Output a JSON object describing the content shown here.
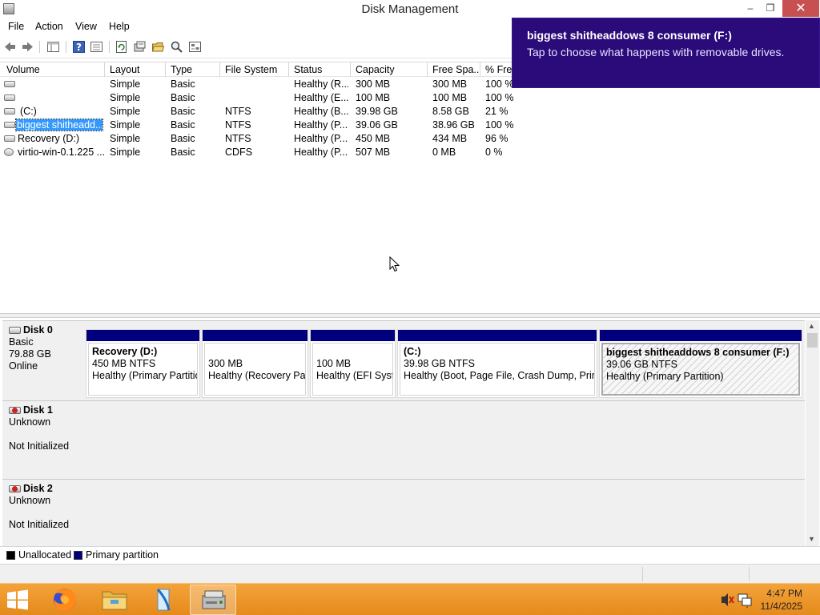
{
  "window": {
    "title": "Disk Management",
    "minimize_glyph": "–",
    "maximize_glyph": "❐",
    "close_glyph": "✕"
  },
  "menu": [
    "File",
    "Action",
    "View",
    "Help"
  ],
  "toolbar_icons": [
    "back-arrow-icon",
    "forward-arrow-icon",
    "console-tree-icon",
    "help-icon",
    "properties-icon",
    "refresh-icon",
    "rescan-disks-icon",
    "open-folder-icon",
    "search-disk-icon",
    "settings-icon"
  ],
  "volume_list": {
    "columns": [
      "Volume",
      "Layout",
      "Type",
      "File System",
      "Status",
      "Capacity",
      "Free Spa...",
      "% Free"
    ],
    "rows": [
      {
        "volume": "",
        "layout": "Simple",
        "type": "Basic",
        "fs": "",
        "status": "Healthy (R...",
        "capacity": "300 MB",
        "free": "300 MB",
        "pct": "100 %",
        "selected": false
      },
      {
        "volume": "",
        "layout": "Simple",
        "type": "Basic",
        "fs": "",
        "status": "Healthy (E...",
        "capacity": "100 MB",
        "free": "100 MB",
        "pct": "100 %",
        "selected": false
      },
      {
        "volume": "(C:)",
        "layout": "Simple",
        "type": "Basic",
        "fs": "NTFS",
        "status": "Healthy (B...",
        "capacity": "39.98 GB",
        "free": "8.58 GB",
        "pct": "21 %",
        "selected": false
      },
      {
        "volume": "biggest shitheadd...",
        "layout": "Simple",
        "type": "Basic",
        "fs": "NTFS",
        "status": "Healthy (P...",
        "capacity": "39.06 GB",
        "free": "38.96 GB",
        "pct": "100 %",
        "selected": true
      },
      {
        "volume": "Recovery (D:)",
        "layout": "Simple",
        "type": "Basic",
        "fs": "NTFS",
        "status": "Healthy (P...",
        "capacity": "450 MB",
        "free": "434 MB",
        "pct": "96 %",
        "selected": false
      },
      {
        "volume": "virtio-win-0.1.225 ...",
        "layout": "Simple",
        "type": "Basic",
        "fs": "CDFS",
        "status": "Healthy (P...",
        "capacity": "507 MB",
        "free": "0 MB",
        "pct": "0 %",
        "selected": false
      }
    ]
  },
  "disks": [
    {
      "name": "Disk 0",
      "info": [
        "Basic",
        "79.88 GB",
        "Online"
      ],
      "partitions": [
        {
          "name": "Recovery  (D:)",
          "size": "450 MB NTFS",
          "status": "Healthy (Primary Partitio",
          "hatched": false
        },
        {
          "name": "",
          "size": "300 MB",
          "status": "Healthy (Recovery Part",
          "hatched": false
        },
        {
          "name": "",
          "size": "100 MB",
          "status": "Healthy (EFI Syste",
          "hatched": false
        },
        {
          "name": "(C:)",
          "size": "39.98 GB NTFS",
          "status": "Healthy (Boot, Page File, Crash Dump, Primar",
          "hatched": false
        },
        {
          "name": "biggest shitheaddows 8 consumer  (F:)",
          "size": "39.06 GB NTFS",
          "status": "Healthy (Primary Partition)",
          "hatched": true
        }
      ]
    },
    {
      "name": "Disk 1",
      "info": [
        "Unknown",
        "",
        "Not Initialized"
      ],
      "partitions": []
    },
    {
      "name": "Disk 2",
      "info": [
        "Unknown",
        "",
        "Not Initialized"
      ],
      "partitions": []
    }
  ],
  "legend": [
    {
      "label": "Unallocated",
      "color": "#000000"
    },
    {
      "label": "Primary partition",
      "color": "#00007f"
    }
  ],
  "toast": {
    "title": "biggest shitheaddows 8 consumer  (F:)",
    "message": "Tap to choose what happens with removable drives."
  },
  "taskbar": {
    "apps": [
      "firefox-icon",
      "file-explorer-icon",
      "pc-settings-icon",
      "disk-management-icon"
    ],
    "time": "4:47 PM",
    "date": "11/4/2025"
  },
  "colors": {
    "primary_partition": "#00007f",
    "selection": "#3399ff",
    "toast_bg": "#2b0a7a",
    "taskbar": "#e58a1c",
    "close_button": "#c75050"
  }
}
